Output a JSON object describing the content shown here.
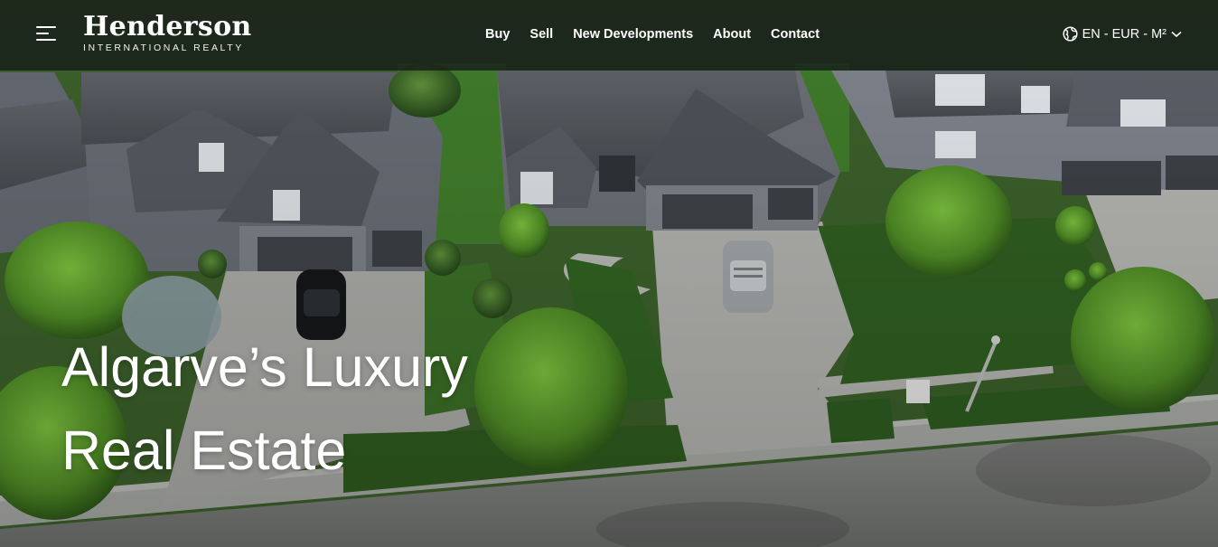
{
  "header": {
    "menu_icon": "hamburger-menu-icon",
    "logo": {
      "name": "Henderson",
      "tagline": "INTERNATIONAL REALTY"
    },
    "nav": [
      {
        "label": "Buy"
      },
      {
        "label": "Sell"
      },
      {
        "label": "New Developments"
      },
      {
        "label": "About"
      },
      {
        "label": "Contact"
      }
    ],
    "locale": {
      "icon": "globe-icon",
      "label": "EN - EUR - M²",
      "chevron": "chevron-down-icon"
    }
  },
  "hero": {
    "headline_line1": "Algarve’s Luxury",
    "headline_line2": "Real Estate"
  },
  "colors": {
    "header_bg": "#1a1e1c",
    "text": "#ffffff",
    "lawn": "#2f5a22"
  }
}
